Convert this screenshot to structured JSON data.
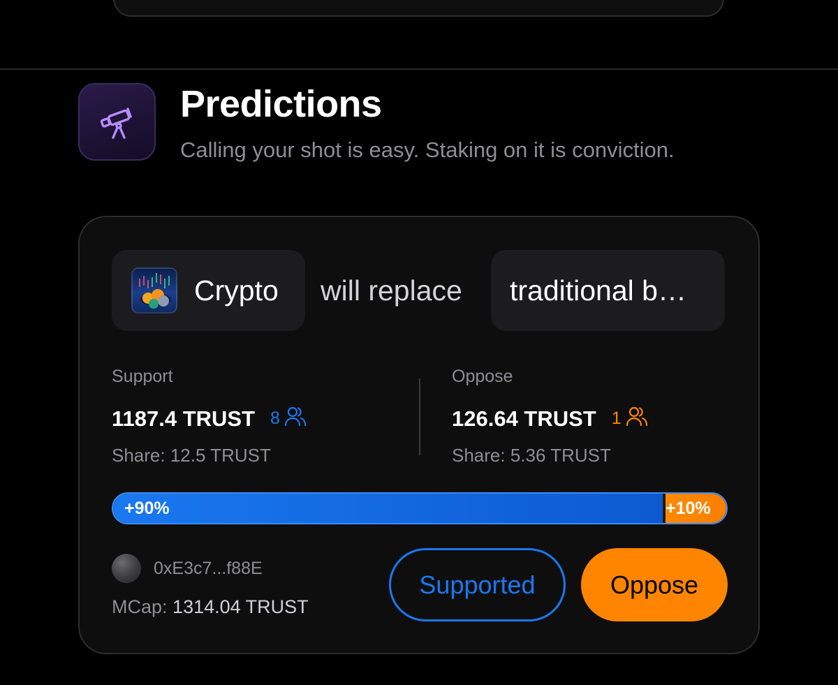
{
  "section": {
    "icon": "telescope-icon",
    "title": "Predictions",
    "subtitle": "Calling your shot is easy. Staking on it is conviction."
  },
  "claim": {
    "subject": "Crypto",
    "subject_icon": "crypto-thumbnail",
    "predicate": "will replace",
    "object": "traditional b…"
  },
  "support": {
    "label": "Support",
    "amount": "1187.4 TRUST",
    "count": "8",
    "share": "Share: 12.5 TRUST",
    "color": "#1a78f0"
  },
  "oppose": {
    "label": "Oppose",
    "amount": "126.64 TRUST",
    "count": "1",
    "share": "Share: 5.36 TRUST",
    "color": "#ff8500"
  },
  "ratio": {
    "support_label": "+90%",
    "oppose_label": "+10%",
    "support_fraction": 0.9
  },
  "creator": {
    "address": "0xE3c7...f88E"
  },
  "mcap": {
    "label": "MCap:",
    "value": "1314.04 TRUST"
  },
  "actions": {
    "supported_label": "Supported",
    "oppose_label": "Oppose"
  }
}
